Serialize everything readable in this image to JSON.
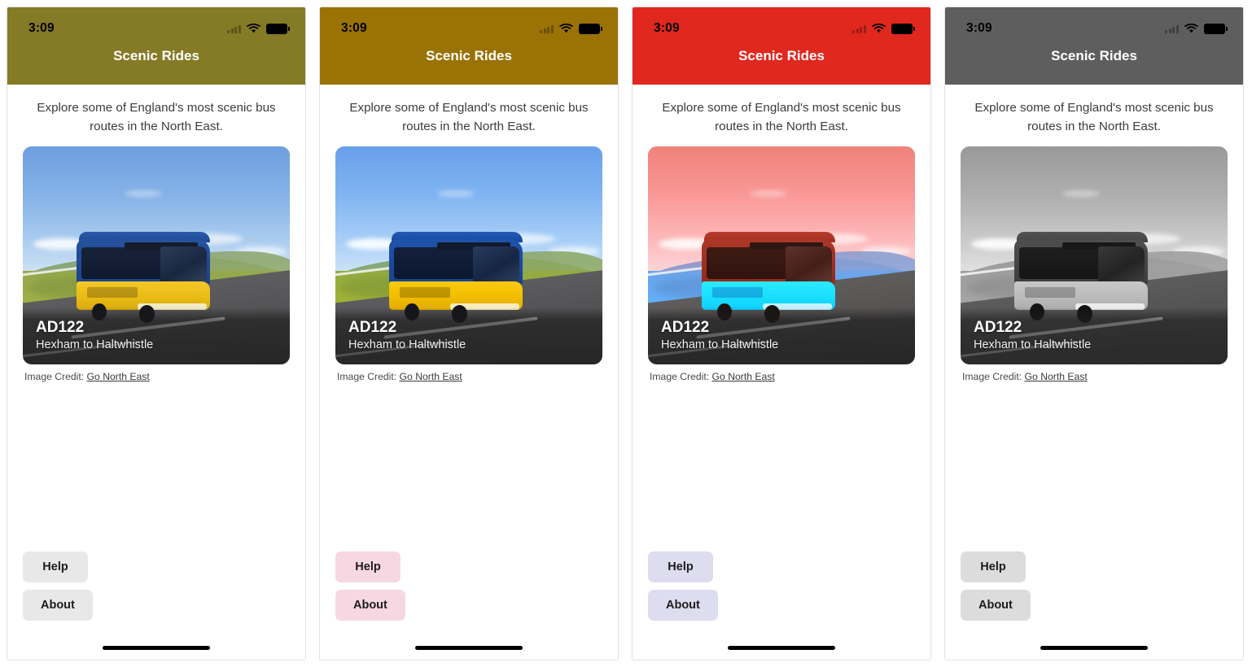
{
  "app": {
    "title": "Scenic Rides",
    "intro": "Explore some of England's most scenic bus routes in the North East.",
    "status_time": "3:09",
    "credit_label": "Image Credit:",
    "credit_link": "Go North East",
    "route_code": "AD122",
    "route_name": "Hexham to Haltwhistle",
    "help_label": "Help",
    "about_label": "About",
    "icons": {
      "signal": "cellular-signal-icon",
      "wifi": "wifi-icon",
      "battery": "battery-icon",
      "home": "home-indicator"
    }
  },
  "screens": [
    {
      "id": "screen-1",
      "theme_name": "olive",
      "header_color": "#857A26",
      "button_color": "#E8E8E8",
      "photo_treatment": "normal"
    },
    {
      "id": "screen-2",
      "theme_name": "gold",
      "header_color": "#9A7206",
      "button_color": "#F7D7E2",
      "photo_treatment": "saturated"
    },
    {
      "id": "screen-3",
      "theme_name": "red",
      "header_color": "#E0281F",
      "button_color": "#DEDCEF",
      "photo_treatment": "hue-rotated"
    },
    {
      "id": "screen-4",
      "theme_name": "gray",
      "header_color": "#5E5E5E",
      "button_color": "#DCDCDC",
      "photo_treatment": "grayscale"
    }
  ]
}
